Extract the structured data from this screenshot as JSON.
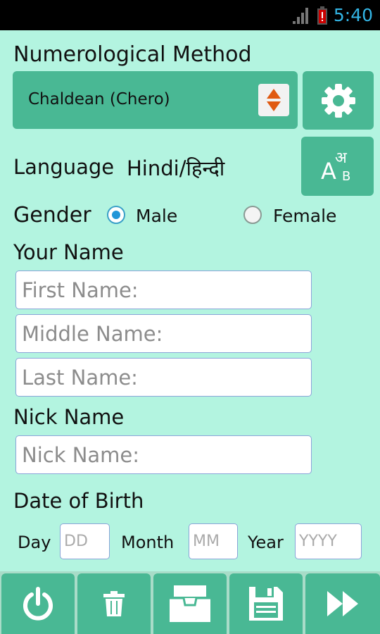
{
  "status": {
    "time": "5:40"
  },
  "method": {
    "label": "Numerological Method",
    "selected": "Chaldean (Chero)"
  },
  "language": {
    "label": "Language",
    "value": "Hindi/हिन्दी",
    "icon_top": "अ",
    "icon_a": "A",
    "icon_b": "B"
  },
  "gender": {
    "label": "Gender",
    "options": [
      "Male",
      "Female"
    ],
    "selected": "Male"
  },
  "name": {
    "label": "Your Name",
    "first_placeholder": "First Name:",
    "middle_placeholder": "Middle Name:",
    "last_placeholder": "Last Name:"
  },
  "nick": {
    "label": "Nick Name",
    "placeholder": "Nick Name:"
  },
  "dob": {
    "label": "Date of Birth",
    "day_label": "Day",
    "day_placeholder": "DD",
    "month_label": "Month",
    "month_placeholder": "MM",
    "year_label": "Year",
    "year_placeholder": "YYYY"
  },
  "toolbar": {
    "icons": [
      "power-icon",
      "trash-icon",
      "folder-icon",
      "save-icon",
      "fast-forward-icon"
    ]
  },
  "colors": {
    "accent": "#49b894",
    "background": "#b3f4e0",
    "status_time": "#33b5e5"
  }
}
